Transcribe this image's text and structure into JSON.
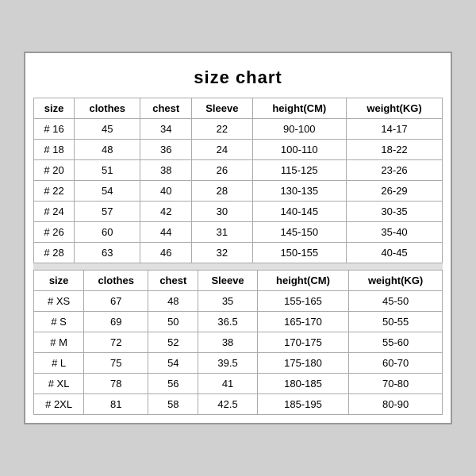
{
  "title": "size chart",
  "headers": [
    "size",
    "clothes",
    "chest",
    "Sleeve",
    "height(CM)",
    "weight(KG)"
  ],
  "section1": [
    [
      "# 16",
      "45",
      "34",
      "22",
      "90-100",
      "14-17"
    ],
    [
      "# 18",
      "48",
      "36",
      "24",
      "100-110",
      "18-22"
    ],
    [
      "# 20",
      "51",
      "38",
      "26",
      "115-125",
      "23-26"
    ],
    [
      "# 22",
      "54",
      "40",
      "28",
      "130-135",
      "26-29"
    ],
    [
      "# 24",
      "57",
      "42",
      "30",
      "140-145",
      "30-35"
    ],
    [
      "# 26",
      "60",
      "44",
      "31",
      "145-150",
      "35-40"
    ],
    [
      "# 28",
      "63",
      "46",
      "32",
      "150-155",
      "40-45"
    ]
  ],
  "section2": [
    [
      "# XS",
      "67",
      "48",
      "35",
      "155-165",
      "45-50"
    ],
    [
      "# S",
      "69",
      "50",
      "36.5",
      "165-170",
      "50-55"
    ],
    [
      "# M",
      "72",
      "52",
      "38",
      "170-175",
      "55-60"
    ],
    [
      "# L",
      "75",
      "54",
      "39.5",
      "175-180",
      "60-70"
    ],
    [
      "# XL",
      "78",
      "56",
      "41",
      "180-185",
      "70-80"
    ],
    [
      "# 2XL",
      "81",
      "58",
      "42.5",
      "185-195",
      "80-90"
    ]
  ]
}
